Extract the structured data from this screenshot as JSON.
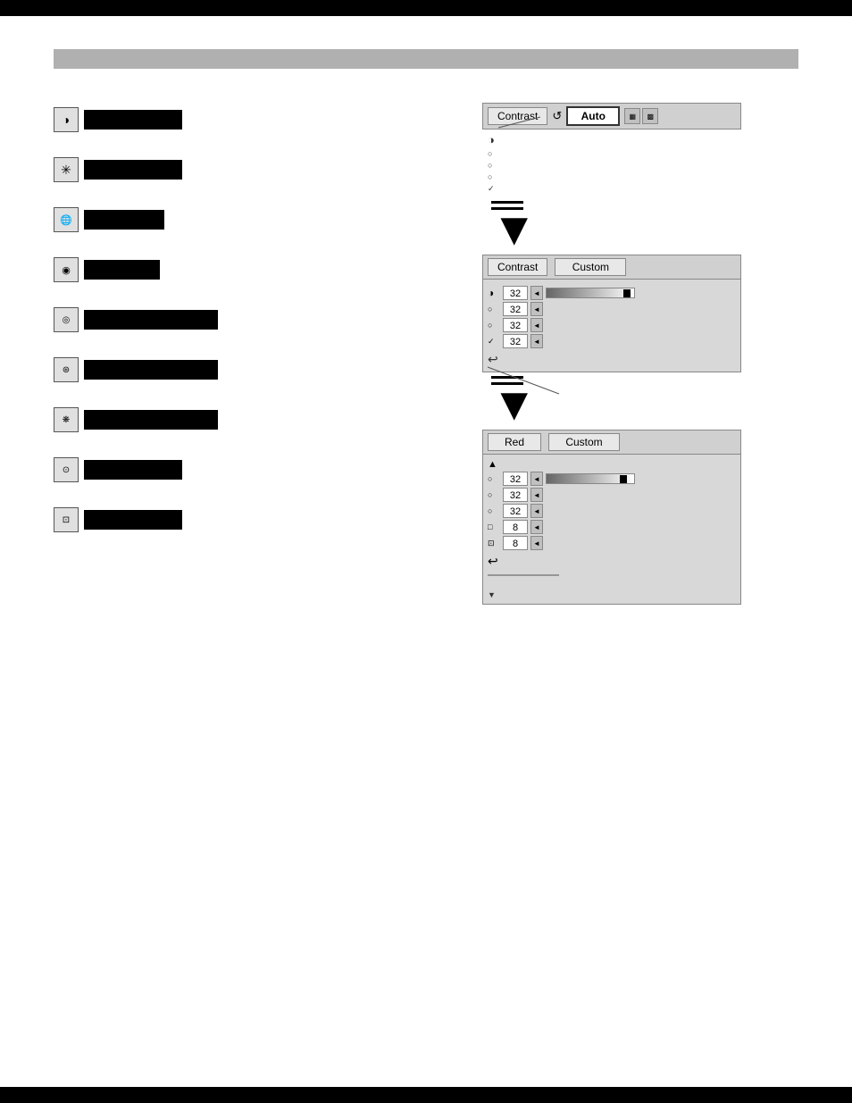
{
  "borders": {
    "top": "top border",
    "bottom": "bottom border"
  },
  "header": {
    "bar_label": ""
  },
  "icon_list": {
    "items": [
      {
        "id": "contrast",
        "icon": "◑",
        "label_width": "short"
      },
      {
        "id": "brightness",
        "icon": "✳",
        "label_width": "short"
      },
      {
        "id": "color",
        "icon": "🌐",
        "label_width": "short"
      },
      {
        "id": "pattern",
        "icon": "🔮",
        "label_width": "short"
      },
      {
        "id": "effect1",
        "icon": "◎",
        "label_width": "long"
      },
      {
        "id": "effect2",
        "icon": "🔵",
        "label_width": "long"
      },
      {
        "id": "effect3",
        "icon": "🌀",
        "label_width": "long"
      },
      {
        "id": "effect4",
        "icon": "⊙",
        "label_width": "short"
      },
      {
        "id": "effect5",
        "icon": "📋",
        "label_width": "short"
      }
    ]
  },
  "panel1": {
    "title": "Contrast",
    "auto_btn": "Auto",
    "refresh_icon": "↺",
    "icons": [
      "◑",
      "○",
      "○",
      "○",
      "✓"
    ]
  },
  "panel2": {
    "title": "Contrast",
    "custom_label": "Custom",
    "values": [
      {
        "val": "32"
      },
      {
        "val": "32"
      },
      {
        "val": "32"
      },
      {
        "val": "32"
      }
    ],
    "slider": {
      "min": 0,
      "max": 100,
      "current": 90
    }
  },
  "panel3": {
    "title": "Red",
    "custom_label": "Custom",
    "values": [
      {
        "val": "32"
      },
      {
        "val": "32"
      },
      {
        "val": "32"
      },
      {
        "val": "8"
      },
      {
        "val": "8"
      }
    ],
    "slider": {
      "min": 0,
      "max": 100,
      "current": 85
    }
  },
  "arrows": {
    "down1": "▼",
    "down2": "▼"
  }
}
